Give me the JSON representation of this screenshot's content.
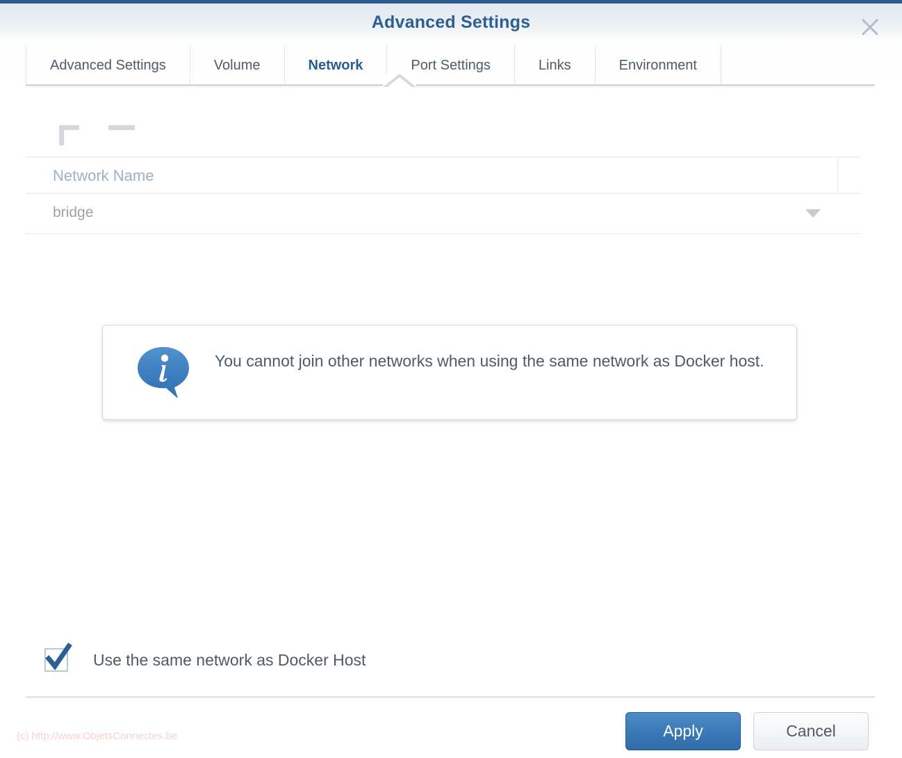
{
  "window": {
    "title": "Advanced Settings",
    "close_icon": "close-icon"
  },
  "tabs": [
    {
      "label": "Advanced Settings",
      "active": false
    },
    {
      "label": "Volume",
      "active": false
    },
    {
      "label": "Network",
      "active": true
    },
    {
      "label": "Port Settings",
      "active": false
    },
    {
      "label": "Links",
      "active": false
    },
    {
      "label": "Environment",
      "active": false
    }
  ],
  "toolbar": {
    "add_icon": "plus-icon",
    "remove_icon": "minus-icon"
  },
  "table": {
    "columns": [
      "Network Name"
    ],
    "rows": [
      {
        "network_name": "bridge",
        "caret_icon": "chevron-down-icon"
      }
    ]
  },
  "info": {
    "icon": "info-speech-bubble-icon",
    "message": "You cannot join other networks when using the same network as Docker host."
  },
  "checkbox": {
    "label": "Use the same network as Docker Host",
    "checked": true,
    "check_icon": "checkmark-icon"
  },
  "footer": {
    "apply_label": "Apply",
    "cancel_label": "Cancel",
    "watermark": "(c) http://www.ObjetsConnectes.be"
  },
  "colors": {
    "title_blue": "#2d5e93",
    "accent_strip": "#2b5a8e",
    "active_tab": "#2a5c92",
    "apply_button": "#3a7ab8",
    "info_bubble": "#3d7dbe",
    "checkmark": "#2d5e93",
    "header_text": "#9db2c7",
    "body_text": "#4d5a67",
    "watermark": "#f7d2d2"
  }
}
